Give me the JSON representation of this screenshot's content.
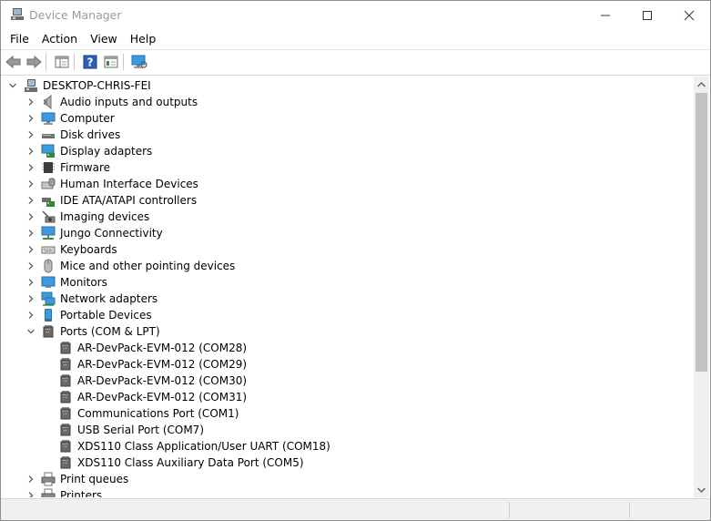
{
  "window": {
    "title": "Device Manager"
  },
  "menu": [
    "File",
    "Action",
    "View",
    "Help"
  ],
  "tree": {
    "root": "DESKTOP-CHRIS-FEI",
    "categories": [
      {
        "label": "Audio inputs and outputs",
        "icon": "speaker-icon",
        "expanded": false
      },
      {
        "label": "Computer",
        "icon": "computer-icon",
        "expanded": false
      },
      {
        "label": "Disk drives",
        "icon": "disk-drive-icon",
        "expanded": false
      },
      {
        "label": "Display adapters",
        "icon": "display-adapter-icon",
        "expanded": false
      },
      {
        "label": "Firmware",
        "icon": "firmware-chip-icon",
        "expanded": false
      },
      {
        "label": "Human Interface Devices",
        "icon": "hid-icon",
        "expanded": false
      },
      {
        "label": "IDE ATA/ATAPI controllers",
        "icon": "ide-controller-icon",
        "expanded": false
      },
      {
        "label": "Imaging devices",
        "icon": "camera-icon",
        "expanded": false
      },
      {
        "label": "Jungo Connectivity",
        "icon": "network-monitor-icon",
        "expanded": false
      },
      {
        "label": "Keyboards",
        "icon": "keyboard-icon",
        "expanded": false
      },
      {
        "label": "Mice and other pointing devices",
        "icon": "mouse-icon",
        "expanded": false
      },
      {
        "label": "Monitors",
        "icon": "monitor-icon",
        "expanded": false
      },
      {
        "label": "Network adapters",
        "icon": "network-adapter-icon",
        "expanded": false
      },
      {
        "label": "Portable Devices",
        "icon": "portable-device-icon",
        "expanded": false
      },
      {
        "label": "Ports (COM & LPT)",
        "icon": "port-icon",
        "expanded": true,
        "children": [
          "AR-DevPack-EVM-012 (COM28)",
          "AR-DevPack-EVM-012 (COM29)",
          "AR-DevPack-EVM-012 (COM30)",
          "AR-DevPack-EVM-012 (COM31)",
          "Communications Port (COM1)",
          "USB Serial Port (COM7)",
          "XDS110 Class Application/User UART (COM18)",
          "XDS110 Class Auxiliary Data Port (COM5)"
        ]
      },
      {
        "label": "Print queues",
        "icon": "printer-icon",
        "expanded": false
      },
      {
        "label": "Printers",
        "icon": "printer-icon",
        "expanded": false
      }
    ]
  },
  "colors": {
    "accent": "#1e73c8",
    "monitor": "#3a9be0",
    "title_text": "#9a9a9a"
  }
}
